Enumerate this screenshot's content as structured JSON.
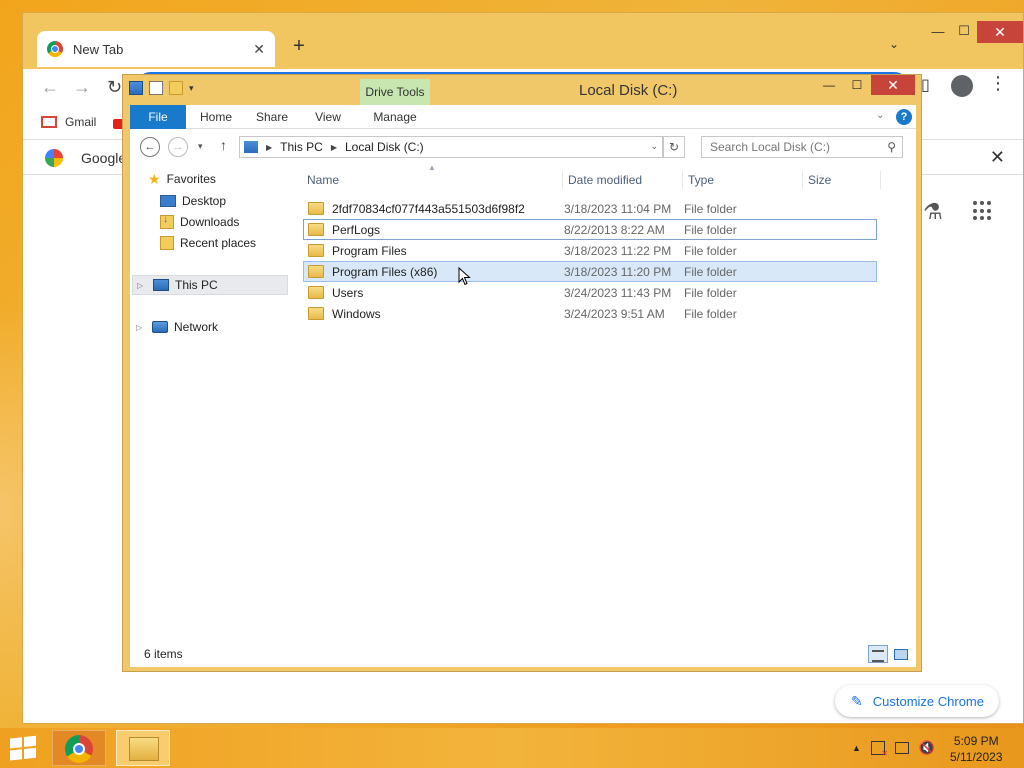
{
  "chrome": {
    "tab_title": "New Tab",
    "tab_close": "✕",
    "new_tab": "+",
    "bookmarks": [
      {
        "label": "Gmail"
      }
    ],
    "google_bar_text": "Google",
    "google_bar_close": "✕",
    "customize_label": "Customize Chrome",
    "win_min": "—",
    "win_max": "☐",
    "win_close": "✕"
  },
  "explorer": {
    "title": "Local Disk (C:)",
    "drive_tools": "Drive Tools",
    "ribbon_tabs": [
      "File",
      "Home",
      "Share",
      "View",
      "Manage"
    ],
    "breadcrumb": [
      "This PC",
      "Local Disk (C:)"
    ],
    "search_placeholder": "Search Local Disk (C:)",
    "nav": {
      "favorites": "Favorites",
      "desktop": "Desktop",
      "downloads": "Downloads",
      "recent": "Recent places",
      "this_pc": "This PC",
      "network": "Network"
    },
    "columns": [
      "Name",
      "Date modified",
      "Type",
      "Size"
    ],
    "files": [
      {
        "name": "2fdf70834cf077f443a551503d6f98f2",
        "date": "3/18/2023 11:04 PM",
        "type": "File folder"
      },
      {
        "name": "PerfLogs",
        "date": "8/22/2013 8:22 AM",
        "type": "File folder"
      },
      {
        "name": "Program Files",
        "date": "3/18/2023 11:22 PM",
        "type": "File folder"
      },
      {
        "name": "Program Files (x86)",
        "date": "3/18/2023 11:20 PM",
        "type": "File folder"
      },
      {
        "name": "Users",
        "date": "3/24/2023 11:43 PM",
        "type": "File folder"
      },
      {
        "name": "Windows",
        "date": "3/24/2023 9:51 AM",
        "type": "File folder"
      }
    ],
    "status": "6 items",
    "win_min": "—",
    "win_max": "☐",
    "win_close": "✕"
  },
  "taskbar": {
    "time": "5:09 PM",
    "date": "5/11/2023"
  },
  "colors": {
    "accent": "#1979ca",
    "desktop": "#f0b43a",
    "close": "#c7443b",
    "chrome_accent": "#1a73e8"
  }
}
